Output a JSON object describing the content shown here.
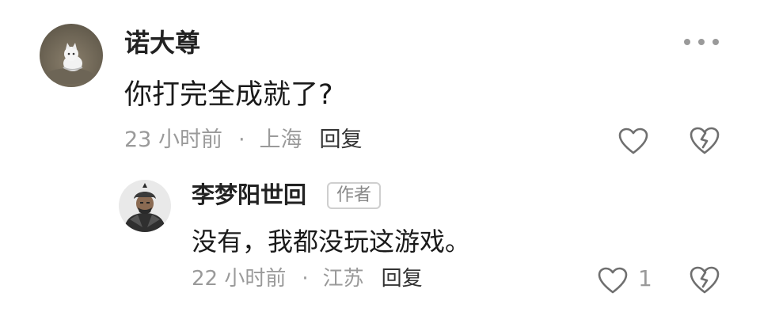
{
  "comment": {
    "username": "诺大尊",
    "text": "你打完全成就了?",
    "time": "23 小时前",
    "separator": "·",
    "location": "上海",
    "reply_label": "回复"
  },
  "reply": {
    "username": "李梦阳世回",
    "badge": "作者",
    "text": "没有，我都没玩这游戏。",
    "time": "22 小时前",
    "separator": "·",
    "location": "江苏",
    "reply_label": "回复",
    "like_count": "1"
  },
  "icons": {
    "more": "more-dots-icon",
    "like": "heart-icon",
    "dislike": "broken-heart-icon"
  },
  "colors": {
    "text_primary": "#1a1a1a",
    "text_secondary": "#9a9a9a",
    "icon_stroke": "#6f6f6f",
    "badge_border": "#cfcfcf"
  }
}
